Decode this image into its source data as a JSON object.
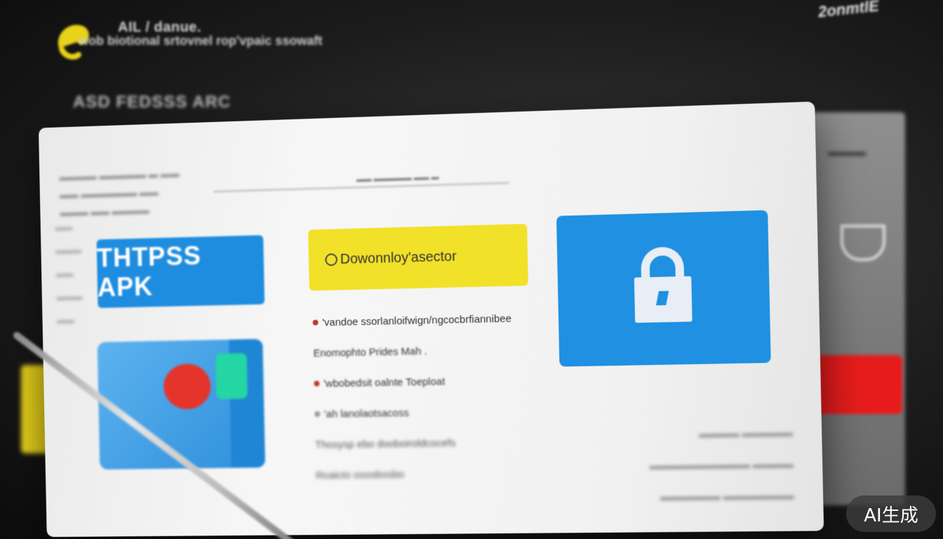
{
  "header": {
    "title": "AIL / danue.",
    "subtitle": "wob biotional srtovnel rop'vpaic ssowaft",
    "section_label": "ASD FEDSSS ARC",
    "brand": "2onmtlE"
  },
  "card": {
    "apk_badge": "THTPSS APK",
    "download_button": "Dowonnloy'asector",
    "features": [
      "'vandoe ssorlanloifwign/ngcocbrfiannibee",
      "Enomophto Prides Mah .",
      "'wbobedsit oalnte Toeploat",
      "'ah lanolaotsacoss",
      "Thosysp ebo dooboiroldcocefs",
      "Roaicto osoobosbo"
    ]
  },
  "overlay": {
    "ai_badge": "AI生成"
  },
  "colors": {
    "accent_blue": "#1f90e2",
    "accent_yellow": "#f2e129",
    "accent_red": "#e71b1b",
    "accent_green": "#23d6a4"
  }
}
